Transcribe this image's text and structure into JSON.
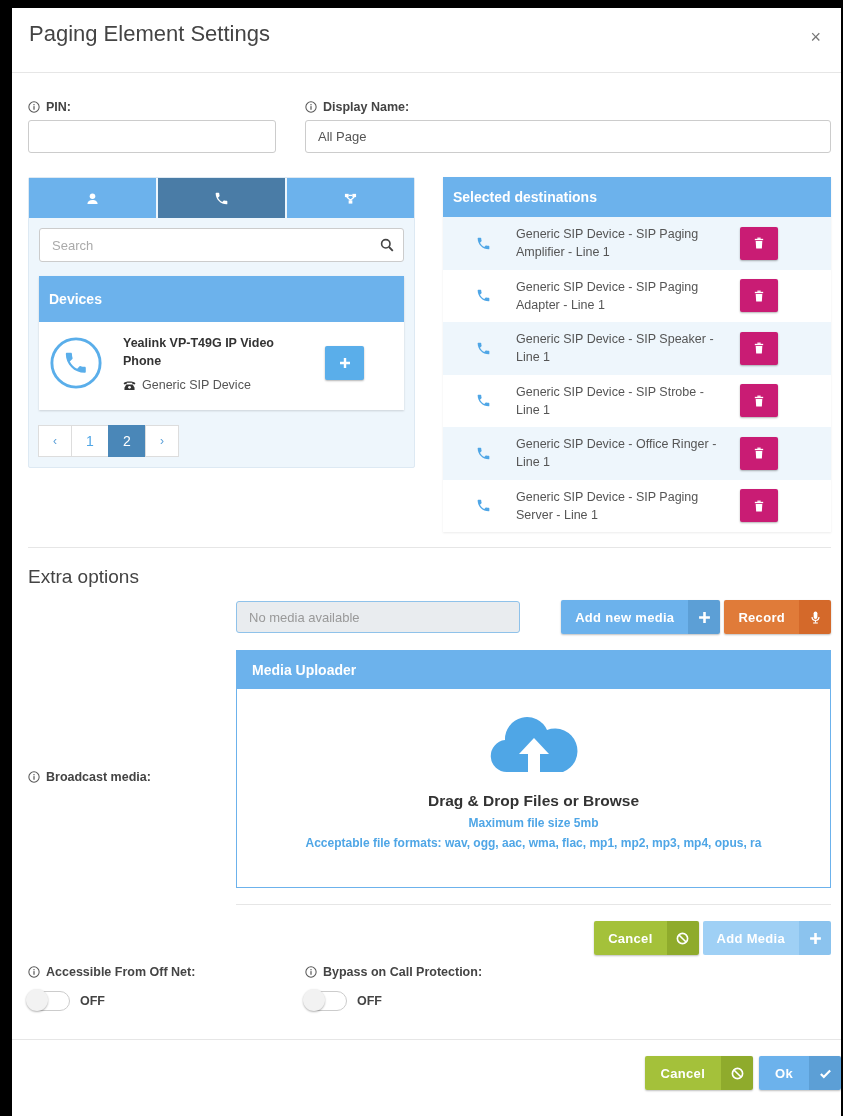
{
  "dialog": {
    "title": "Paging Element Settings",
    "close": "×"
  },
  "pin": {
    "label": "PIN:"
  },
  "display_name": {
    "label": "Display Name:",
    "value": "All Page"
  },
  "source_tabs": [
    {
      "kind": "user",
      "selected": false
    },
    {
      "kind": "phone",
      "selected": true
    },
    {
      "kind": "group",
      "selected": false
    }
  ],
  "search": {
    "placeholder": "Search"
  },
  "devices": {
    "title": "Devices",
    "items": [
      {
        "name": "Yealink VP-T49G IP Video Phone",
        "type": "Generic SIP Device"
      }
    ]
  },
  "pagination": {
    "prev": "‹",
    "pages": [
      {
        "label": "1",
        "selected": false
      },
      {
        "label": "2",
        "selected": true
      }
    ],
    "next": "›"
  },
  "destinations": {
    "title": "Selected destinations",
    "items": [
      "Generic SIP Device - SIP Paging Amplifier - Line 1",
      "Generic SIP Device - SIP Paging Adapter - Line 1",
      "Generic SIP Device - SIP Speaker - Line 1",
      "Generic SIP Device - SIP Strobe - Line 1",
      "Generic SIP Device - Office Ringer - Line 1",
      "Generic SIP Device - SIP Paging Server - Line 1"
    ]
  },
  "extra_options": {
    "title": "Extra options",
    "broadcast_label": "Broadcast media:",
    "media_field": {
      "placeholder": "No media available"
    },
    "media_buttons": [
      {
        "label": "Add new media",
        "kind": "add",
        "disabled": false
      },
      {
        "label": "Record",
        "kind": "record",
        "disabled": false
      }
    ],
    "uploader": {
      "title": "Media Uploader",
      "heading": "Drag & Drop Files or Browse",
      "max_size": "Maximum file size 5mb",
      "formats": "Acceptable file formats: wav, ogg, aac, wma, flac, mp1, mp2, mp3, mp4, opus, ra"
    },
    "uploader_buttons": [
      {
        "label": "Cancel",
        "kind": "cancel",
        "disabled": false
      },
      {
        "label": "Add Media",
        "kind": "add",
        "disabled": true
      }
    ]
  },
  "toggles": [
    {
      "label": "Accessible From Off Net:",
      "on": false,
      "state_text": "OFF"
    },
    {
      "label": "Bypass on Call Protection:",
      "on": false,
      "state_text": "OFF"
    }
  ],
  "footer_buttons": [
    {
      "label": "Cancel",
      "kind": "cancel",
      "disabled": false
    },
    {
      "label": "Ok",
      "kind": "ok",
      "disabled": false
    }
  ]
}
